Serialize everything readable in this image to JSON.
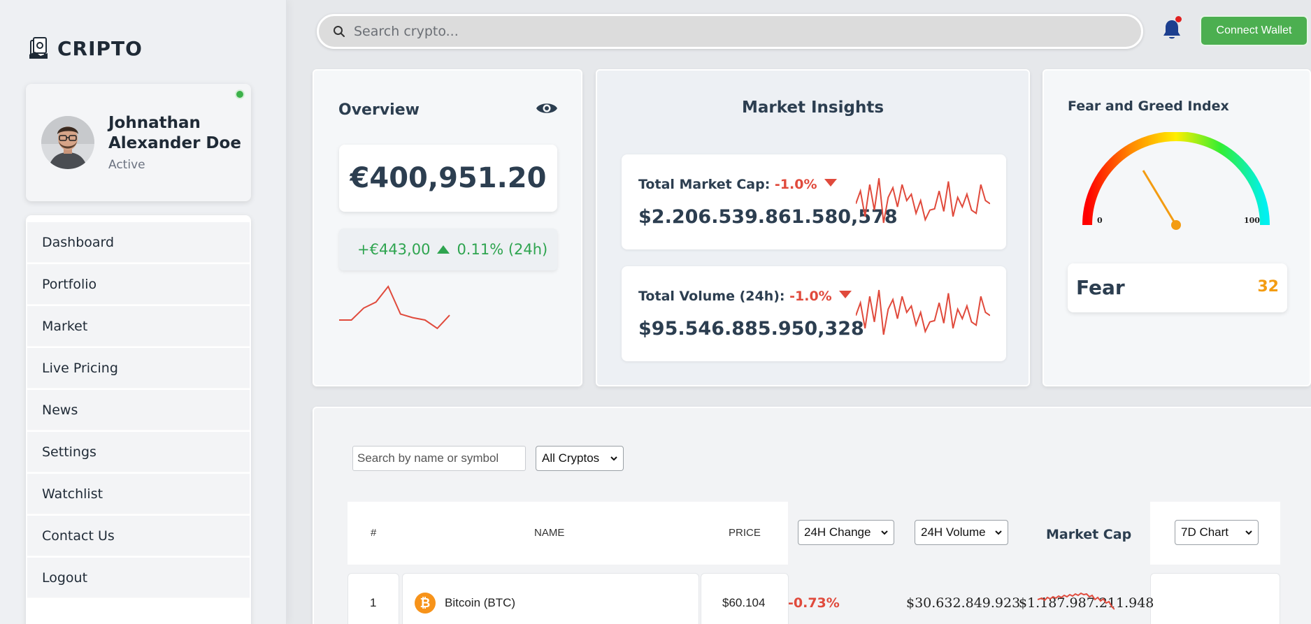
{
  "brand": {
    "name": "CRIPTO",
    "icon": "money-stack-icon"
  },
  "profile": {
    "name": "Johnathan Alexander Doe",
    "status": "Active",
    "online_color": "#3cb14a"
  },
  "nav": {
    "items": [
      {
        "label": "Dashboard"
      },
      {
        "label": "Portfolio"
      },
      {
        "label": "Market"
      },
      {
        "label": "Live Pricing"
      },
      {
        "label": "News"
      },
      {
        "label": "Settings"
      },
      {
        "label": "Watchlist"
      },
      {
        "label": "Contact Us"
      },
      {
        "label": "Logout"
      }
    ]
  },
  "header": {
    "search_placeholder": "Search crypto...",
    "wallet_button": "Connect Wallet",
    "notification_icon": "bell-icon"
  },
  "overview": {
    "title": "Overview",
    "balance": "€400,951.20",
    "change_amount": "+€443,00",
    "change_percent": "0.11% (24h)",
    "spark": [
      70,
      70,
      60,
      55,
      42,
      65,
      68,
      70,
      77,
      66
    ]
  },
  "insights": {
    "title": "Market Insights",
    "market_cap": {
      "label": "Total Market Cap:",
      "change": "-1.0%",
      "value": "$2.206.539.861.580,578",
      "spark": [
        50,
        30,
        70,
        20,
        60,
        10,
        80,
        40,
        25,
        55,
        20,
        45,
        35,
        65,
        45,
        75,
        60,
        58,
        30,
        62,
        15,
        70,
        40,
        55,
        35,
        60,
        65,
        20,
        45,
        50
      ]
    },
    "volume": {
      "label": "Total Volume (24h):",
      "change": "-1.0%",
      "value": "$95.546.885.950,328",
      "spark": [
        50,
        30,
        70,
        20,
        60,
        10,
        80,
        40,
        25,
        55,
        20,
        45,
        35,
        65,
        45,
        75,
        60,
        58,
        30,
        62,
        15,
        70,
        40,
        55,
        35,
        60,
        65,
        20,
        45,
        50
      ]
    },
    "down_color": "#e04a3c"
  },
  "fear_greed": {
    "title": "Fear and Greed Index",
    "min_label": "0",
    "max_label": "100",
    "label": "Fear",
    "value": "32",
    "value_color": "#f39c12"
  },
  "table": {
    "filter_placeholder": "Search by name or symbol",
    "filter_select": "All Cryptos",
    "headers": {
      "rank": "#",
      "name": "NAME",
      "price": "PRICE",
      "change_select": "24H Change",
      "volume_select": "24H Volume",
      "market_cap": "Market Cap",
      "chart_select": "7D Chart"
    },
    "rows": [
      {
        "rank": "1",
        "name": "Bitcoin (BTC)",
        "icon": "bitcoin-icon",
        "price": "$60.104",
        "change": "-0.73%",
        "volume": "$30.632.849.923",
        "market_cap": "$1.187.987.211.948"
      }
    ]
  }
}
